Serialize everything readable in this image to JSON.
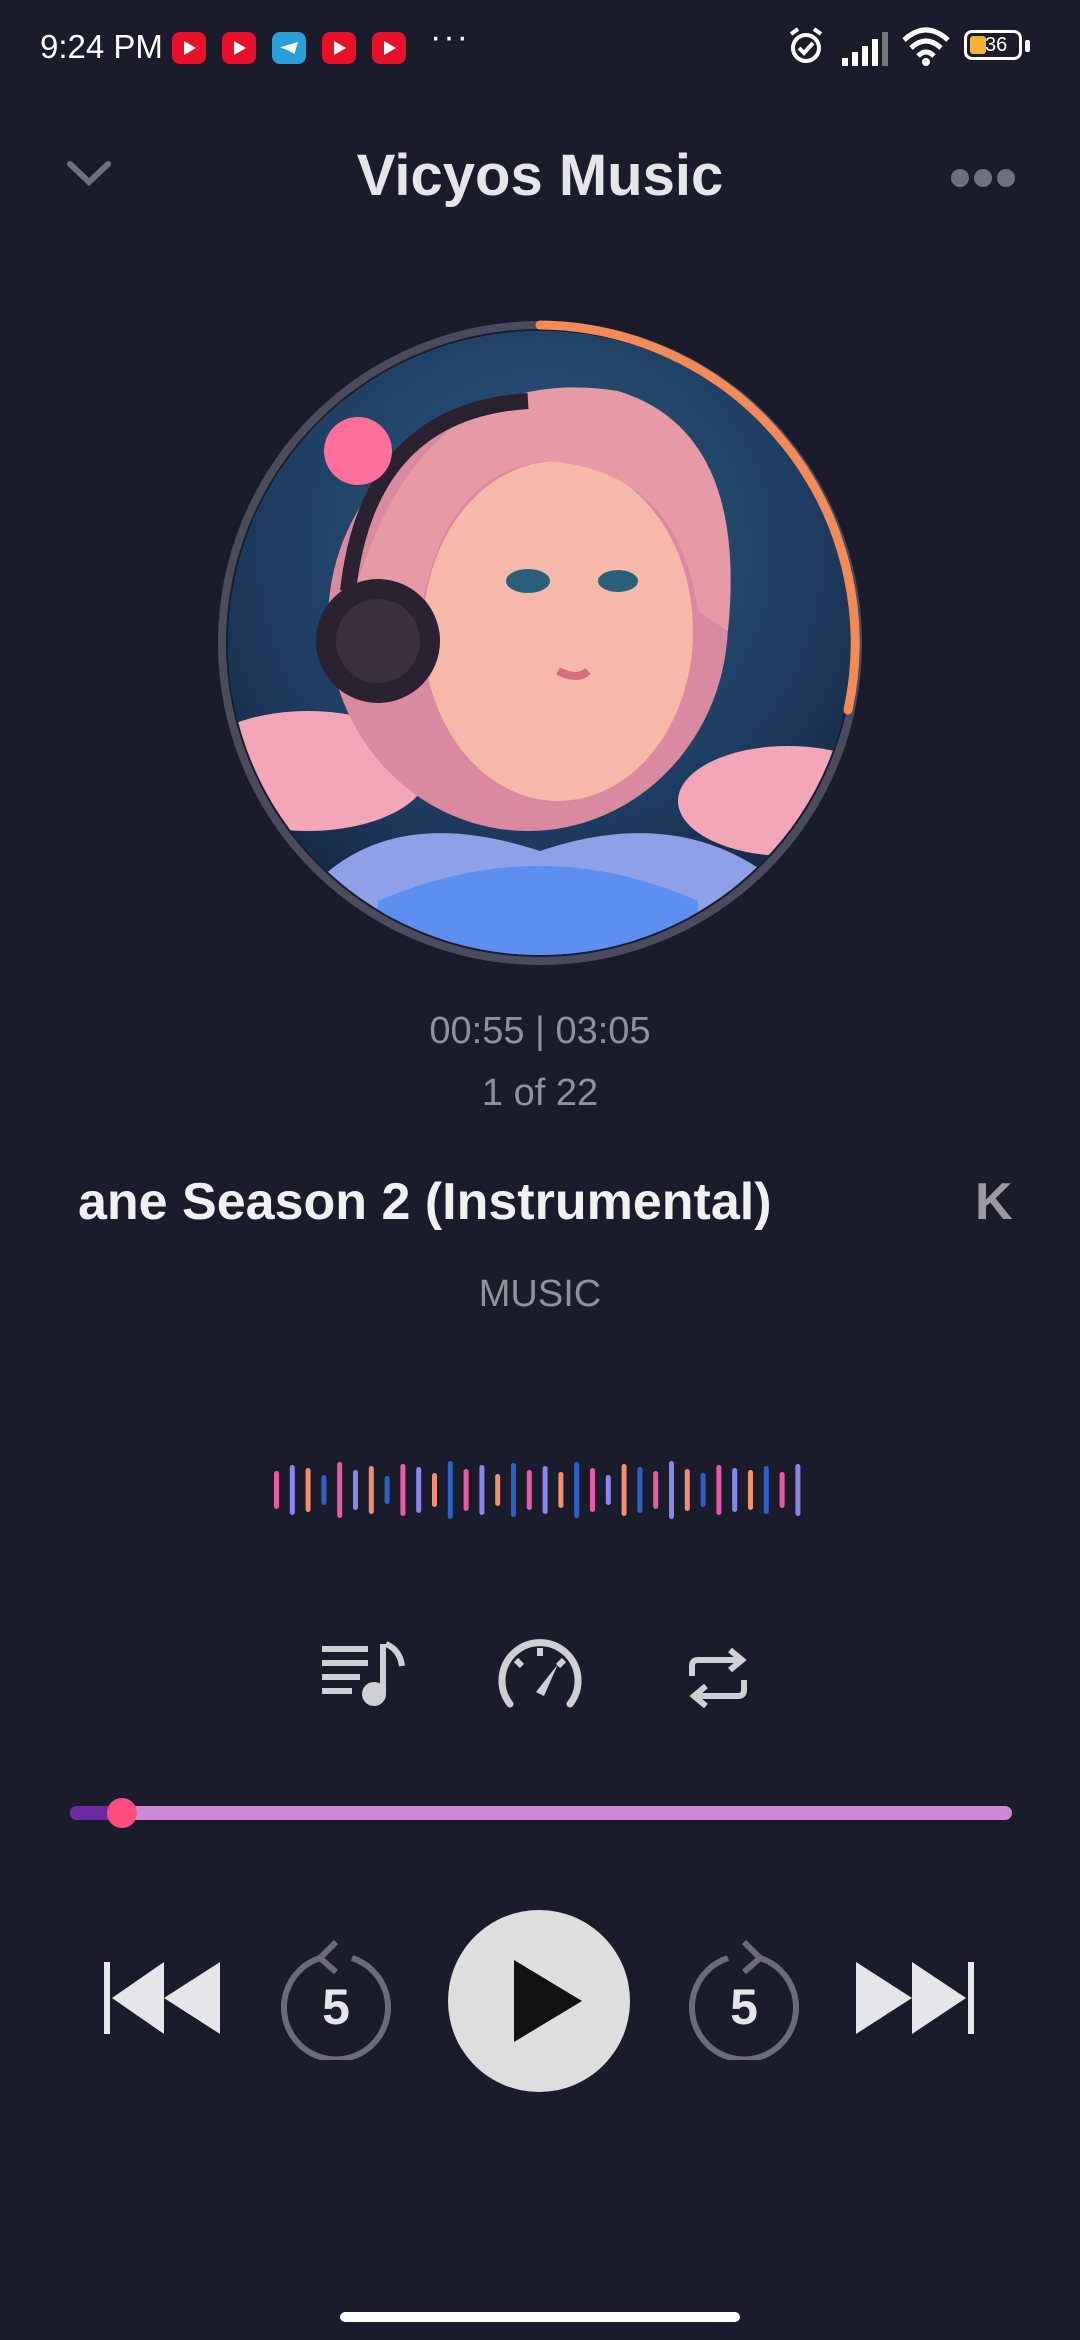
{
  "status_bar": {
    "time": "9:24 PM",
    "more": "···",
    "battery": "36",
    "notification_icons": [
      "youtube-icon",
      "youtube-icon",
      "telegram-icon",
      "youtube-icon",
      "youtube-icon"
    ]
  },
  "header": {
    "title": "Vicyos Music",
    "back_icon": "chevron-down-icon",
    "menu_icon": "more-horizontal-icon"
  },
  "player": {
    "elapsed_total": "00:55 | 03:05",
    "position": "1 of 22",
    "title": "ane Season 2 (Instrumental)",
    "next_title_peek": "K",
    "artist": "MUSIC",
    "progress_fraction": 0.055
  },
  "controls": {
    "icons": [
      "playlist-icon",
      "speed-gauge-icon",
      "repeat-icon"
    ],
    "rewind_seconds": "5",
    "forward_seconds": "5"
  },
  "colors": {
    "background": "#1b1c2b",
    "accent_orange": "#f48a57",
    "progress_track": "#cc88d4",
    "progress_fill": "#6b2aa0",
    "progress_thumb": "#ff4d7f",
    "wave_colors": [
      "#e95aa6",
      "#8a86f0",
      "#f09070",
      "#2b62c8"
    ]
  }
}
